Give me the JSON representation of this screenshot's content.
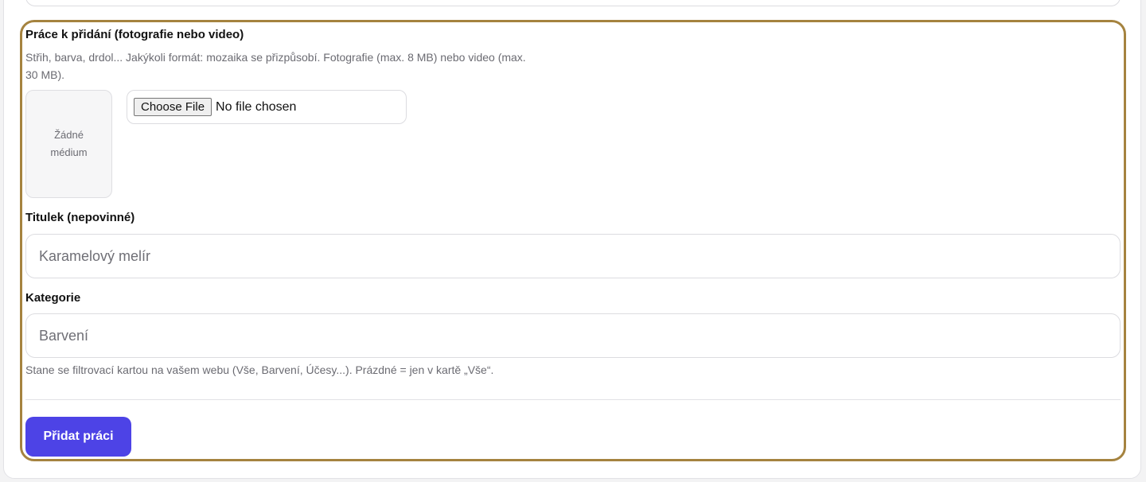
{
  "form": {
    "media_label": "Práce k přidání (fotografie nebo video)",
    "media_help_line1": "Střih, barva, drdol... Jakýkoli formát: mozaika se přizpůsobí. Fotografie (max. 8 MB) nebo video (max.",
    "media_help_line2": "30 MB).",
    "preview_empty_text": "Žádné médium",
    "file_button_label": "Choose File",
    "file_status": "No file chosen",
    "title_label": "Titulek (nepovinné)",
    "title_placeholder": "Karamelový melír",
    "category_label": "Kategorie",
    "category_placeholder": "Barvení",
    "category_help": "Stane se filtrovací kartou na vašem webu (Vše, Barvení, Účesy...). Prázdné = jen v kartě „Vše“.",
    "submit_label": "Přidat práci"
  },
  "colors": {
    "accent_border": "#a5833f",
    "primary_button": "#4d43e6"
  }
}
